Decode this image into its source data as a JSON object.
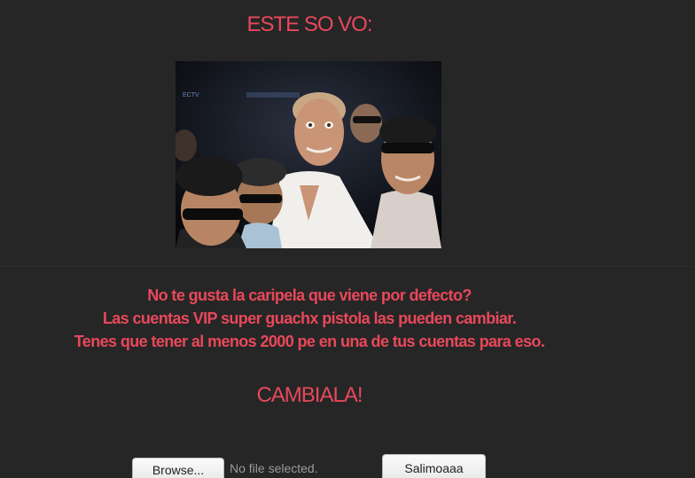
{
  "header": {
    "title": "ESTE SO VO:"
  },
  "profile_image": {
    "alt": "group photo",
    "overlay_text": "ECTV"
  },
  "message": {
    "line1": "No te gusta la caripela que viene por defecto?",
    "line2": "Las cuentas VIP super guachx pistola las pueden cambiar.",
    "line3": "Tenes que tener al menos 2000 pe en una de tus cuentas para eso."
  },
  "cta": {
    "label": "CAMBIALA!"
  },
  "upload": {
    "browse_label": "Browse...",
    "file_status": "No file selected.",
    "submit_label": "Salimoaaa"
  },
  "colors": {
    "background": "#262626",
    "accent": "#e8485a"
  }
}
